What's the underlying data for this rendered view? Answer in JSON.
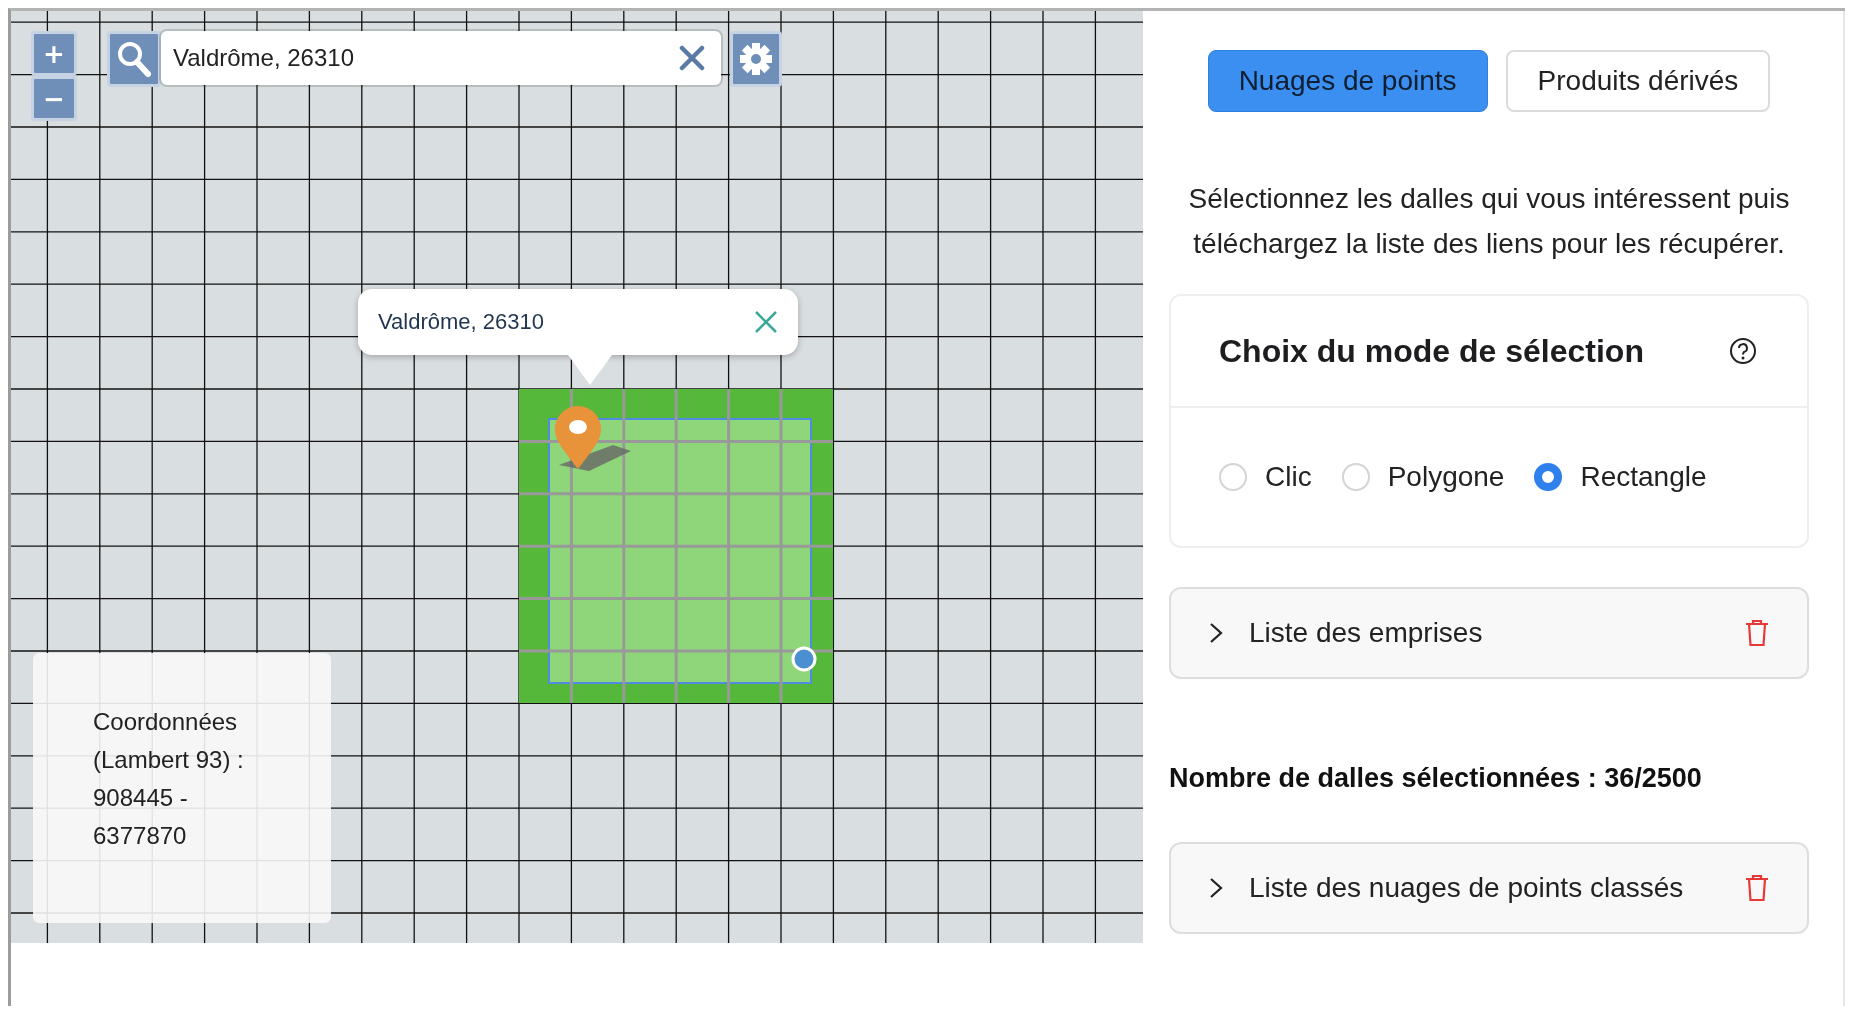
{
  "map": {
    "zoom_in": "+",
    "zoom_out": "−",
    "search": {
      "value": "Valdrôme, 26310"
    },
    "popup": {
      "text": "Valdrôme, 26310"
    },
    "coordinates": "Coordonnées (Lambert 93) : 908445 - 6377870"
  },
  "panel": {
    "tabs": [
      {
        "label": "Nuages de points",
        "selected": true
      },
      {
        "label": "Produits dérivés",
        "selected": false
      }
    ],
    "description": "Sélectionnez les dalles qui vous intéressent puis téléchargez la liste des liens pour les récupérer.",
    "selection_mode": {
      "title": "Choix du mode de sélection",
      "options": [
        {
          "label": "Clic",
          "selected": false
        },
        {
          "label": "Polygone",
          "selected": false
        },
        {
          "label": "Rectangle",
          "selected": true
        }
      ]
    },
    "extents": {
      "label": "Liste des emprises",
      "expanded": false
    },
    "count": "Nombre de dalles sélectionnées : 36/2500",
    "point_clouds": {
      "label": "Liste des nuages de points classés",
      "expanded": false
    }
  }
}
